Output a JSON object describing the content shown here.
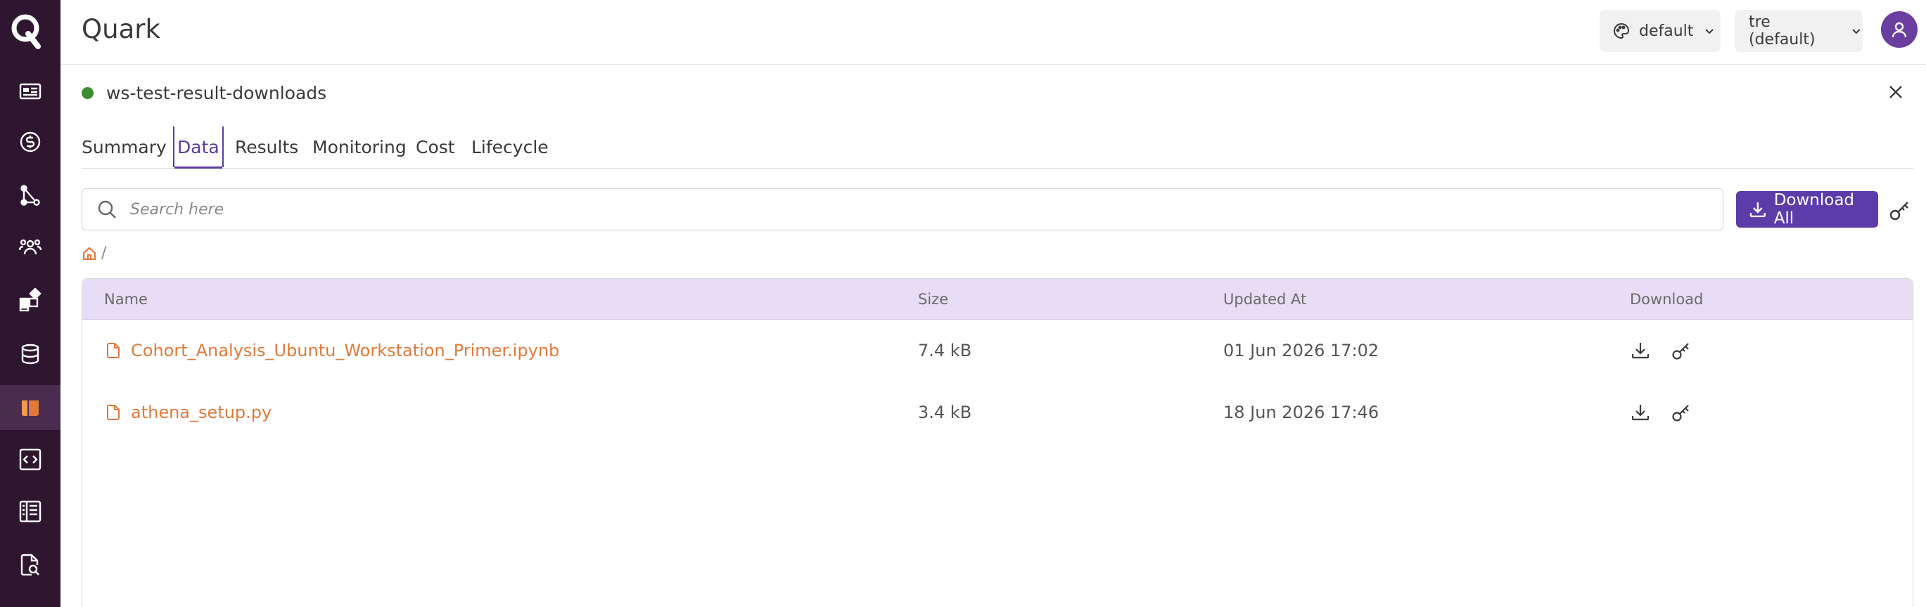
{
  "app": {
    "title": "Quark"
  },
  "header": {
    "theme_label": "default",
    "env_label": "tre (default)"
  },
  "workspace": {
    "name": "ws-test-result-downloads",
    "status_color": "#3c8c2f"
  },
  "tabs": [
    {
      "label": "Summary",
      "active": false
    },
    {
      "label": "Data",
      "active": true
    },
    {
      "label": "Results",
      "active": false
    },
    {
      "label": "Monitoring",
      "active": false
    },
    {
      "label": "Cost",
      "active": false
    },
    {
      "label": "Lifecycle",
      "active": false
    }
  ],
  "search": {
    "placeholder": "Search here"
  },
  "toolbar": {
    "download_all_label": "Download All"
  },
  "breadcrumb": {
    "separator": "/"
  },
  "table": {
    "columns": [
      "Name",
      "Size",
      "Updated At",
      "Download"
    ],
    "rows": [
      {
        "name": "Cohort_Analysis_Ubuntu_Workstation_Primer.ipynb",
        "size": "7.4 kB",
        "updated_at": "01 Jun 2026 17:02"
      },
      {
        "name": "athena_setup.py",
        "size": "3.4 kB",
        "updated_at": "18 Jun 2026 17:46"
      }
    ]
  },
  "sidebar": {
    "items": [
      {
        "icon": "news-icon"
      },
      {
        "icon": "dollar-icon"
      },
      {
        "icon": "workflow-icon"
      },
      {
        "icon": "team-icon"
      },
      {
        "icon": "apps-icon"
      },
      {
        "icon": "database-icon"
      },
      {
        "icon": "workspace-icon",
        "active": true
      },
      {
        "icon": "code-icon"
      },
      {
        "icon": "notebook-icon"
      },
      {
        "icon": "file-search-icon"
      }
    ]
  },
  "colors": {
    "sidebar_bg": "#2e1630",
    "accent": "#5b3ca8",
    "file_link": "#e07a3a",
    "table_header_bg": "#e7def5"
  }
}
